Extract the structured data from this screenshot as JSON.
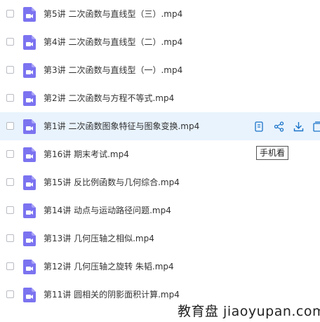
{
  "files": [
    {
      "name": "第5讲 二次函数与直线型（三）.mp4",
      "hover": false
    },
    {
      "name": "第4讲 二次函数与直线型（二）.mp4",
      "hover": false
    },
    {
      "name": "第3讲 二次函数与直线型（一）.mp4",
      "hover": false
    },
    {
      "name": "第2讲 二次函数与方程不等式.mp4",
      "hover": false
    },
    {
      "name": "第1讲 二次函数图象特征与图象变换.mp4",
      "hover": true
    },
    {
      "name": "第16讲 期末考试.mp4",
      "hover": false
    },
    {
      "name": "第15讲 反比例函数与几何综合.mp4",
      "hover": false
    },
    {
      "name": "第14讲 动点与运动路径问题.mp4",
      "hover": false
    },
    {
      "name": "第13讲 几何压轴之相似.mp4",
      "hover": false
    },
    {
      "name": "第12讲 几何压轴之旋转 朱韬.mp4",
      "hover": false
    },
    {
      "name": "第11讲 圆相关的阴影面积计算.mp4",
      "hover": false
    }
  ],
  "row_actions": [
    "phone-view-icon",
    "share-icon",
    "download-icon",
    "more-icon"
  ],
  "tooltip": "手机看",
  "watermark": "教育盘 jiaoyupan.com",
  "colors": {
    "video_icon": "#7b73f0",
    "hover_bg": "#e8f3fd",
    "action_icon": "#1a73c9"
  }
}
